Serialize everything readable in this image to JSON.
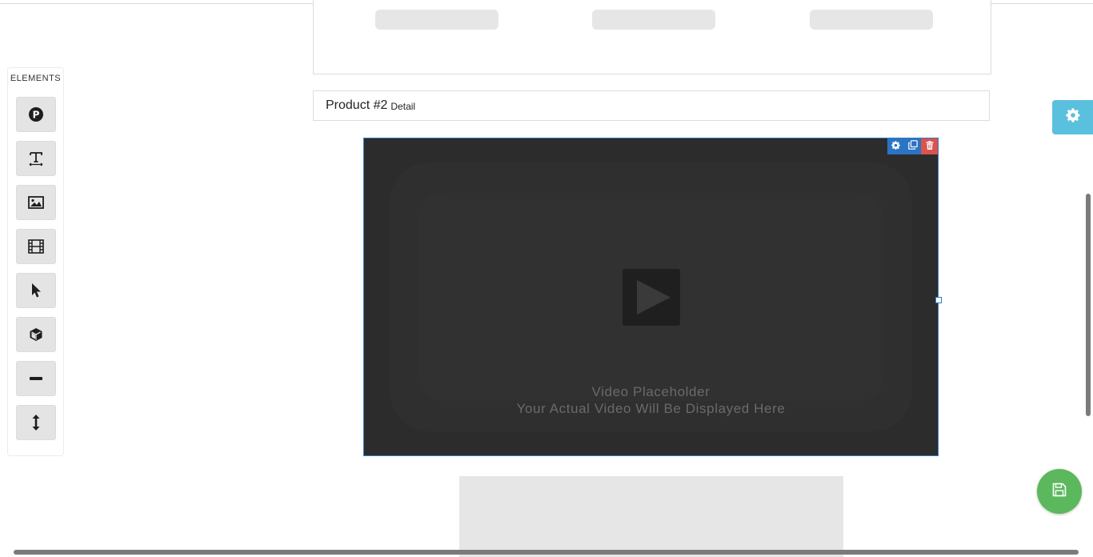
{
  "sidebar": {
    "title": "ELEMENTS",
    "tools": [
      {
        "name": "product-element",
        "icon": "product-p-icon"
      },
      {
        "name": "text-element",
        "icon": "text-icon"
      },
      {
        "name": "image-element",
        "icon": "image-icon"
      },
      {
        "name": "video-element",
        "icon": "film-icon"
      },
      {
        "name": "button-element",
        "icon": "cursor-icon"
      },
      {
        "name": "box-element",
        "icon": "cube-icon"
      },
      {
        "name": "divider-element",
        "icon": "minus-icon"
      },
      {
        "name": "spacer-element",
        "icon": "vertical-arrows-icon"
      }
    ]
  },
  "product_header": {
    "title": "Product #2",
    "subtitle": "Detail"
  },
  "video": {
    "line1": "Video Placeholder",
    "line2": "Your Actual Video Will Be Displayed Here",
    "tools": [
      {
        "name": "settings",
        "icon": "gear-icon",
        "color": "#2a74c3"
      },
      {
        "name": "duplicate",
        "icon": "copy-icon",
        "color": "#2a74c3"
      },
      {
        "name": "delete",
        "icon": "trash-icon",
        "color": "#d9534f"
      }
    ]
  },
  "floating": {
    "settings_icon": "gear-icon",
    "settings_color": "#5bc0de",
    "save_icon": "floppy-disk-icon",
    "save_color": "#5cb85c"
  },
  "colors": {
    "selection": "#2d78c6",
    "video_bg": "#2c2c2c"
  }
}
